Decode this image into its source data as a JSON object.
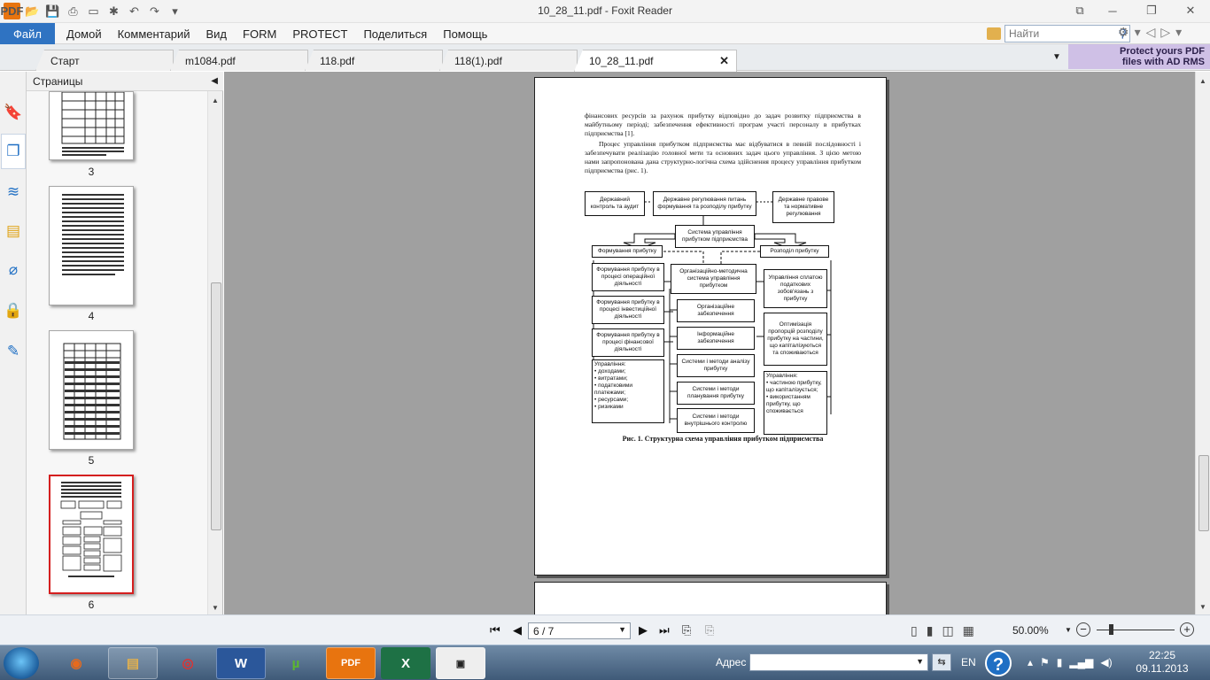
{
  "window": {
    "title": "10_28_11.pdf - Foxit Reader"
  },
  "ribbon": {
    "file_label": "Файл",
    "menus": [
      "Домой",
      "Комментарий",
      "Вид",
      "FORM",
      "PROTECT",
      "Поделиться",
      "Помощь"
    ],
    "search_placeholder": "Найти"
  },
  "tabs": [
    {
      "label": "Старт",
      "active": false
    },
    {
      "label": "m1084.pdf",
      "active": false
    },
    {
      "label": "118.pdf",
      "active": false
    },
    {
      "label": "118(1).pdf",
      "active": false
    },
    {
      "label": "10_28_11.pdf",
      "active": true
    }
  ],
  "promo": {
    "line1": "Protect yours PDF",
    "line2": "files with AD RMS"
  },
  "pages_panel": {
    "title": "Страницы",
    "thumbs": [
      {
        "number": "3",
        "selected": false
      },
      {
        "number": "4",
        "selected": false
      },
      {
        "number": "5",
        "selected": false
      },
      {
        "number": "6",
        "selected": true
      }
    ]
  },
  "document": {
    "para1": "фінансових ресурсів за рахунок прибутку відповідно до задач розвитку підприємства в майбутньому періоді; забезпечення ефективності програм участі персоналу в прибутках підприємства [1].",
    "para2": "Процес управління прибутком підприємства має відбуватися в певній послідовності і забезпечувати реалізацію головної мети та основних задач цього управління. З цією метою нами запропонована дана структурно-логічна схема здійснення процесу управління прибутком підприємства (рис. 1).",
    "diagram": {
      "top_left": "Державний контроль та аудит",
      "top_center": "Державне регулювання питань формування та розподілу прибутку",
      "top_right": "Державне правове та нормативне регулювання",
      "system": "Система управління прибутком підприємства",
      "formation": "Формування прибутку",
      "distribution": "Розподіл прибутку",
      "form_operational": "Формування прибутку в процесі операційної діяльності",
      "form_investment": "Формування прибутку в процесі інвестиційної діяльності",
      "form_financial": "Формування прибутку в процесі фінансової діяльності",
      "management_left": "Управління:\n• доходами;\n• витратами;\n• податковими платежами;\n• ресурсами;\n• ризиками",
      "org_method": "Організаційно-методична система управління прибутком",
      "org_support": "Організаційне забезпечення",
      "info_support": "Інформаційне забезпечення",
      "analysis": "Системи і методи аналізу прибутку",
      "planning": "Системи і методи планування прибутку",
      "control": "Системи і методи внутрішнього контролю",
      "tax_mgmt": "Управління сплатою податкових зобов'язань з прибутку",
      "optimization": "Оптимізація пропорцій розподілу прибутку на частини, що капіталізуються та споживаються",
      "management_right": "Управління:\n• частиною прибутку, що капіталізується;\n• використанням прибутку, що споживається"
    },
    "caption": "Рис. 1. Структурна схема управління прибутком підприємства"
  },
  "statusbar": {
    "page_indicator": "6 / 7",
    "zoom": "50.00%"
  },
  "taskbar": {
    "address_label": "Адрес",
    "lang": "EN",
    "time": "22:25",
    "date": "09.11.2013"
  }
}
